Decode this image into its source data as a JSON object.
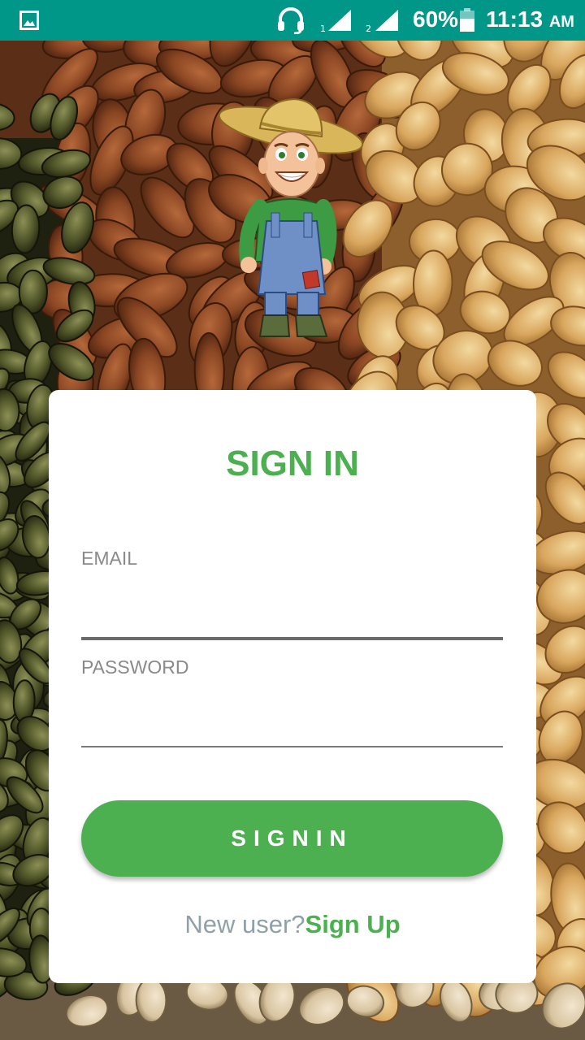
{
  "status_bar": {
    "battery_percent": "60%",
    "time": "11:13",
    "ampm": "AM",
    "sim1_label": "1",
    "sim2_label": "2",
    "icons": [
      "gallery-icon",
      "headset-icon",
      "signal-icon",
      "battery-icon"
    ]
  },
  "signin": {
    "title": "SIGN IN",
    "email_label": "EMAIL",
    "email_value": "",
    "password_label": "PASSWORD",
    "password_value": "",
    "button_label": "SIGNIN",
    "new_user_prompt": "New user?",
    "signup_link": "Sign Up"
  },
  "colors": {
    "status_bar": "#009688",
    "accent_green": "#4caf50",
    "prompt_gray": "#8fa0a6",
    "label_gray": "#8a8a8a",
    "card": "#ffffff"
  }
}
